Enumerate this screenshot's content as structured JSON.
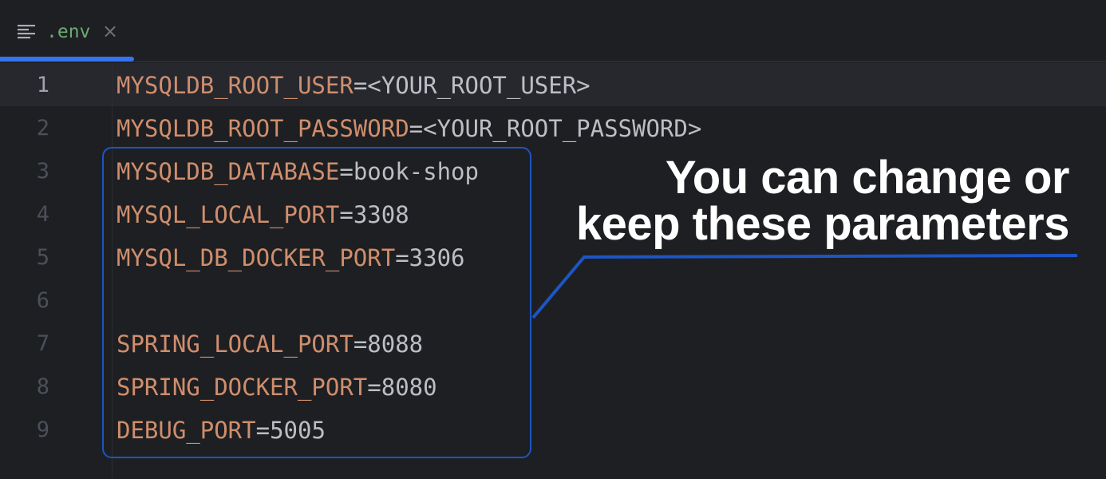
{
  "tab": {
    "icon": "text-file-icon",
    "label": ".env",
    "close_glyph": "×",
    "accent_color": "#3574f0"
  },
  "editor": {
    "active_line": 1,
    "lines": [
      {
        "number": "1",
        "key": "MYSQLDB_ROOT_USER",
        "eq": "=",
        "value": "<YOUR_ROOT_USER>"
      },
      {
        "number": "2",
        "key": "MYSQLDB_ROOT_PASSWORD",
        "eq": "=",
        "value": "<YOUR_ROOT_PASSWORD>"
      },
      {
        "number": "3",
        "key": "MYSQLDB_DATABASE",
        "eq": "=",
        "value": "book-shop"
      },
      {
        "number": "4",
        "key": "MYSQL_LOCAL_PORT",
        "eq": "=",
        "value": "3308"
      },
      {
        "number": "5",
        "key": "MYSQL_DB_DOCKER_PORT",
        "eq": "=",
        "value": "3306"
      },
      {
        "number": "6",
        "key": "",
        "eq": "",
        "value": ""
      },
      {
        "number": "7",
        "key": "SPRING_LOCAL_PORT",
        "eq": "=",
        "value": "8088"
      },
      {
        "number": "8",
        "key": "SPRING_DOCKER_PORT",
        "eq": "=",
        "value": "8080"
      },
      {
        "number": "9",
        "key": "DEBUG_PORT",
        "eq": "=",
        "value": "5005"
      }
    ]
  },
  "annotation": {
    "line1": "You can change or",
    "line2": "keep these parameters",
    "box_color": "#1d55c4"
  }
}
